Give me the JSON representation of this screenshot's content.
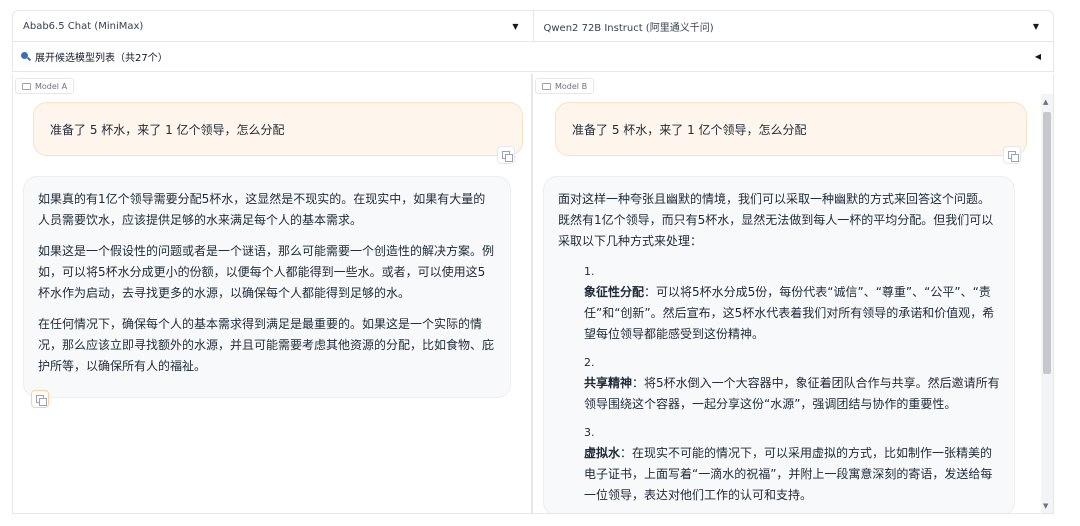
{
  "top": {
    "model_a": "Abab6.5 Chat (MiniMax)",
    "model_b": "Qwen2 72B Instruct (阿里通义千问)"
  },
  "expand": {
    "label": "展开候选模型列表（共27个）"
  },
  "panel_a": {
    "label": "Model A",
    "user_msg": "准备了 5 杯水，来了 1 亿个领导，怎么分配",
    "reply": [
      "如果真的有1亿个领导需要分配5杯水，这显然是不现实的。在现实中，如果有大量的人员需要饮水，应该提供足够的水来满足每个人的基本需求。",
      "如果这是一个假设性的问题或者是一个谜语，那么可能需要一个创造性的解决方案。例如，可以将5杯水分成更小的份额，以便每个人都能得到一些水。或者，可以使用这5杯水作为启动，去寻找更多的水源，以确保每个人都能得到足够的水。",
      "在任何情况下，确保每个人的基本需求得到满足是最重要的。如果这是一个实际的情况，那么应该立即寻找额外的水源，并且可能需要考虑其他资源的分配，比如食物、庇护所等，以确保所有人的福祉。"
    ]
  },
  "panel_b": {
    "label": "Model B",
    "user_msg": "准备了 5 杯水，来了 1 亿个领导，怎么分配",
    "intro": "面对这样一种夸张且幽默的情境，我们可以采取一种幽默的方式来回答这个问题。既然有1亿个领导，而只有5杯水，显然无法做到每人一杯的平均分配。但我们可以采取以下几种方式来处理：",
    "items": [
      {
        "num": "1.",
        "title": "象征性分配",
        "text": "：可以将5杯水分成5份，每份代表“诚信”、“尊重”、“公平”、“责任”和“创新”。然后宣布，这5杯水代表着我们对所有领导的承诺和价值观，希望每位领导都能感受到这份精神。"
      },
      {
        "num": "2.",
        "title": "共享精神",
        "text": "：将5杯水倒入一个大容器中，象征着团队合作与共享。然后邀请所有领导围绕这个容器，一起分享这份“水源”，强调团结与协作的重要性。"
      },
      {
        "num": "3.",
        "title": "虚拟水",
        "text": "：在现实不可能的情况下，可以采用虚拟的方式，比如制作一张精美的电子证书，上面写着“一滴水的祝福”，并附上一段寓意深刻的寄语，发送给每一位领导，表达对他们工作的认可和支持。"
      }
    ]
  },
  "icons": {
    "search": "search-icon",
    "copy": "copy-icon",
    "chat": "chat-bubble-icon"
  }
}
